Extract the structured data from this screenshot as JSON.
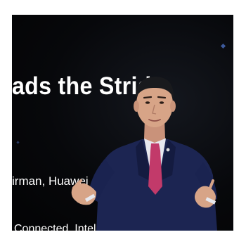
{
  "slide": {
    "headline": "ads the Stride",
    "subtitle": "irman, Huawei",
    "tagline": "Connected, Intelliger"
  },
  "colors": {
    "background": "#05060a",
    "text": "#ffffff",
    "suit": "#1c2552",
    "tie": "#c23a6a",
    "shirt": "#e7e8ee",
    "skin": "#d7a487",
    "hair": "#191a1d",
    "accent": "#3d5a9c"
  }
}
